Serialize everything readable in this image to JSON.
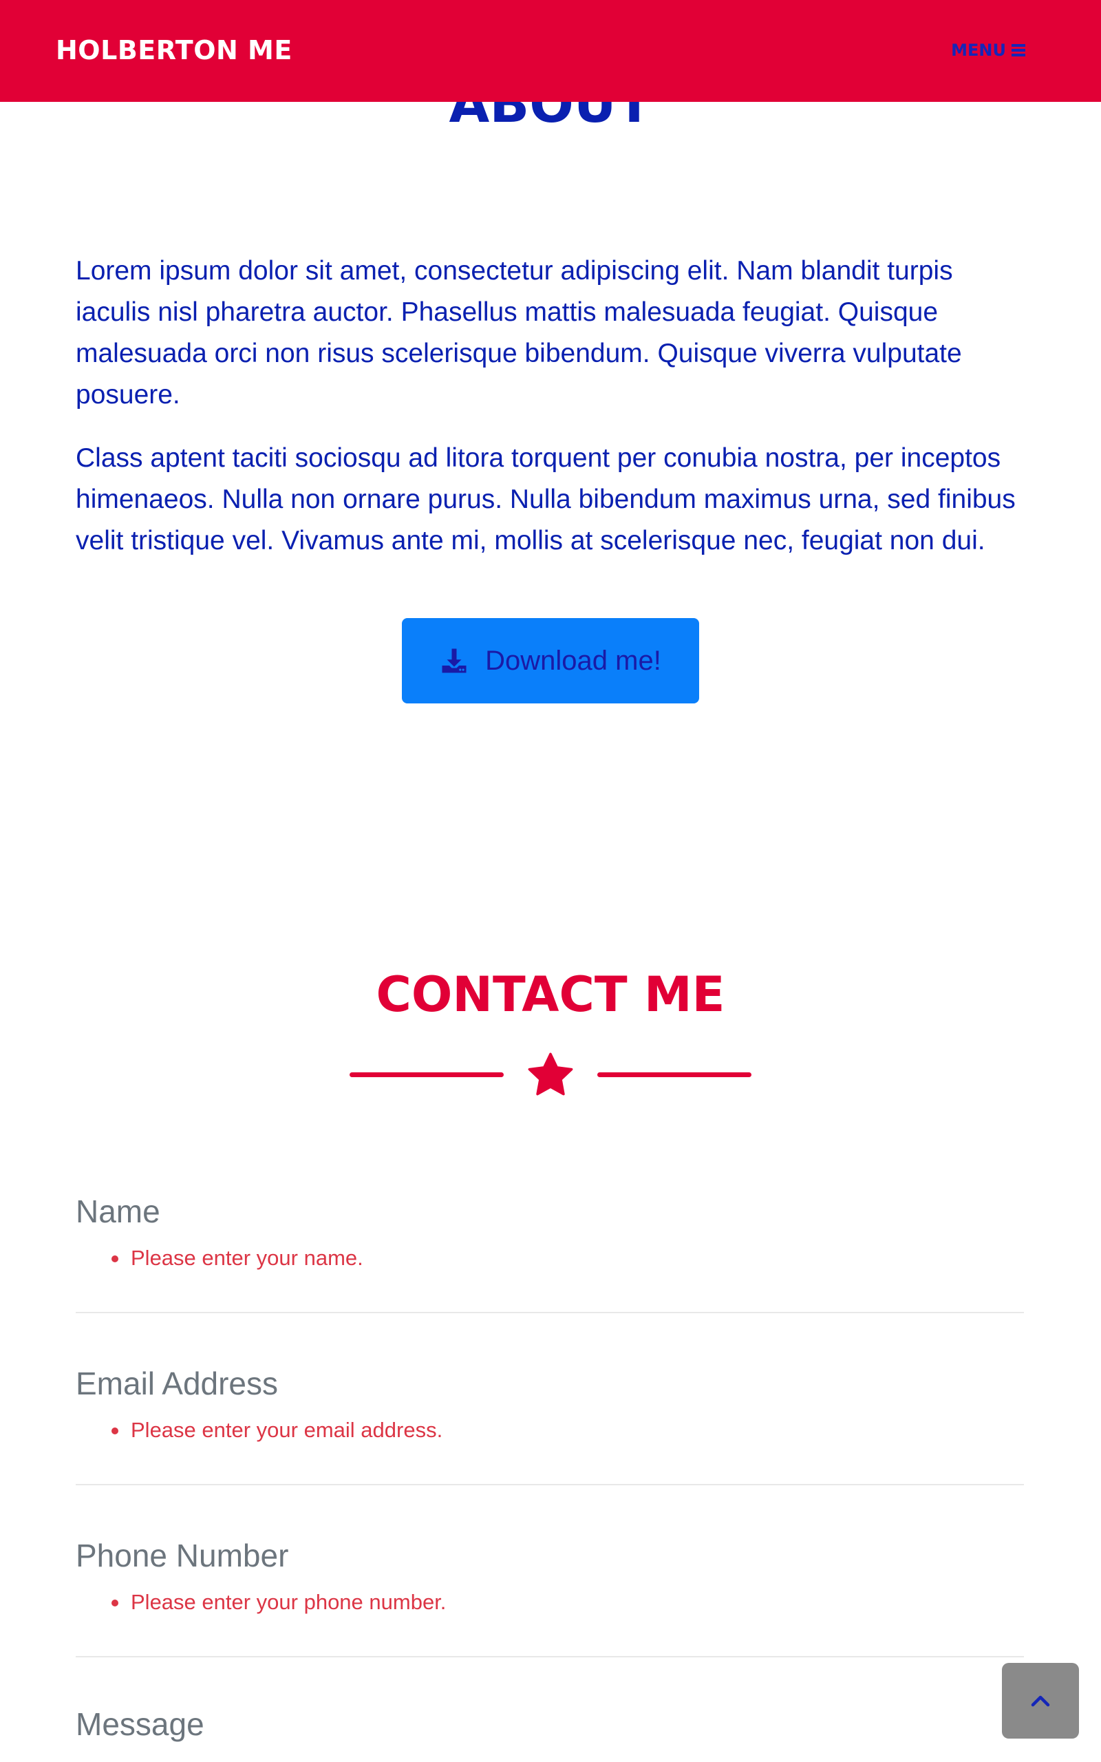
{
  "navbar": {
    "brand": "HOLBERTON ME",
    "menu_label": "MENU",
    "menu_icon": "hamburger-icon",
    "background": "#e10036"
  },
  "about": {
    "title": "ABOUT",
    "paragraphs": [
      "Lorem ipsum dolor sit amet, consectetur adipiscing elit. Nam blandit turpis iaculis nisl pharetra auctor. Phasellus mattis malesuada feugiat. Quisque malesuada orci non risus scelerisque bibendum. Quisque viverra vulputate posuere.",
      "Class aptent taciti sociosqu ad litora torquent per conubia nostra, per inceptos himenaeos. Nulla non ornare purus. Nulla bibendum maximus urna, sed finibus velit tristique vel. Vivamus ante mi, mollis at scelerisque nec, feugiat non dui."
    ],
    "download_label": "Download me!",
    "download_icon": "download-icon",
    "text_color": "#0a20b0",
    "button_color": "#0a7ffa"
  },
  "contact": {
    "title": "CONTACT ME",
    "divider_icon": "star-icon",
    "accent_color": "#e10036",
    "fields": [
      {
        "label": "Name",
        "error": "Please enter your name."
      },
      {
        "label": "Email Address",
        "error": "Please enter your email address."
      },
      {
        "label": "Phone Number",
        "error": "Please enter your phone number."
      },
      {
        "label": "Message"
      }
    ],
    "error_color": "#dc3545"
  },
  "back_to_top": {
    "icon": "chevron-up-icon"
  }
}
